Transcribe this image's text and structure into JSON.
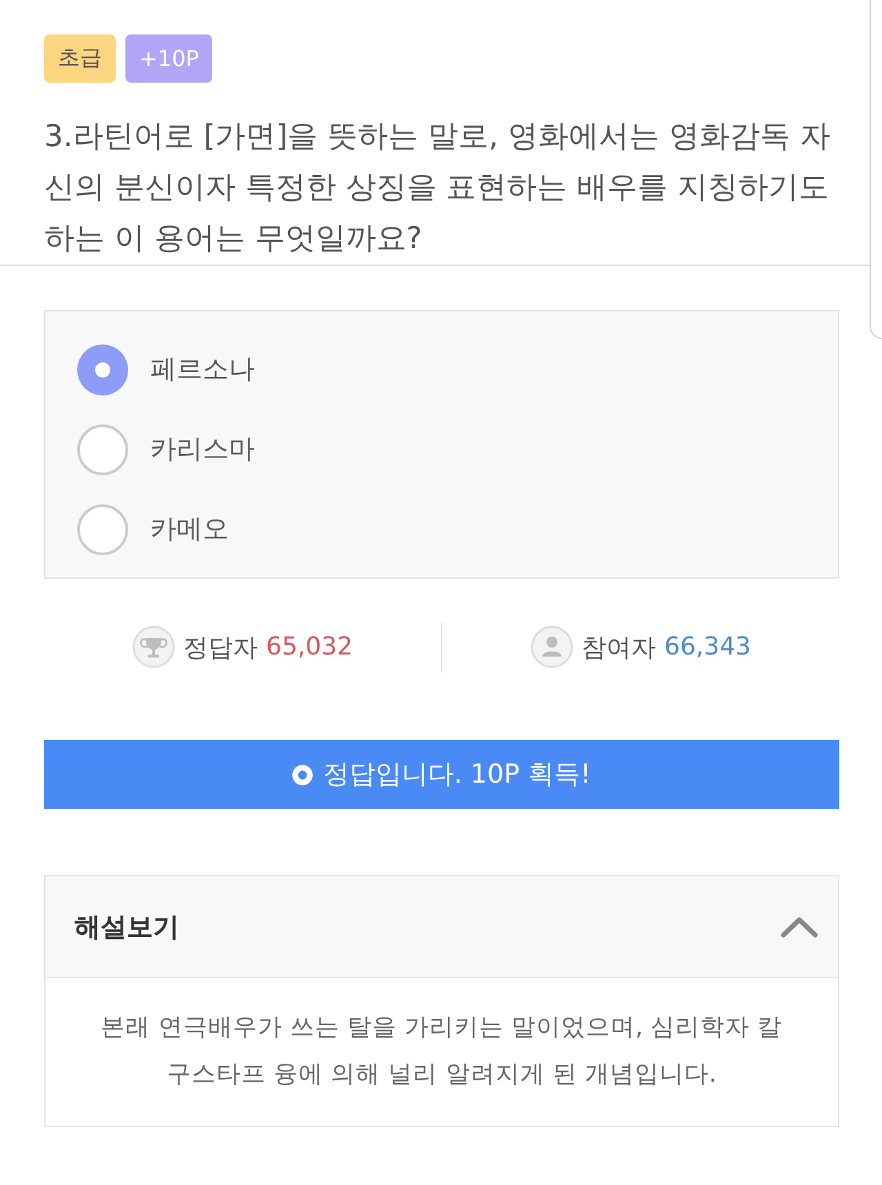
{
  "badges": [
    {
      "kind": "level",
      "label": "초급"
    },
    {
      "kind": "points",
      "label": "+10P"
    }
  ],
  "question": "3.라틴어로 [가면]을 뜻하는 말로, 영화에서는 영화감독 자신의 분신이자 특정한 상징을 표현하는 배우를 지칭하기도 하는 이 용어는 무엇일까요?",
  "options": [
    {
      "label": "페르소나",
      "selected": true
    },
    {
      "label": "카리스마",
      "selected": false
    },
    {
      "label": "카메오",
      "selected": false
    }
  ],
  "stats": [
    {
      "kind": "correct",
      "label": "정답자",
      "count": "65,032"
    },
    {
      "kind": "participants",
      "label": "참여자",
      "count": "66,343"
    }
  ],
  "result": {
    "text": "정답입니다. 10P 획득!"
  },
  "explanation": {
    "title": "해설보기",
    "expanded": true,
    "body": "본래 연극배우가 쓰는 탈을 가리키는 말이었으며, 심리학자 칼 구스타프 융에 의해 널리 알려지게 된 개념입니다."
  }
}
